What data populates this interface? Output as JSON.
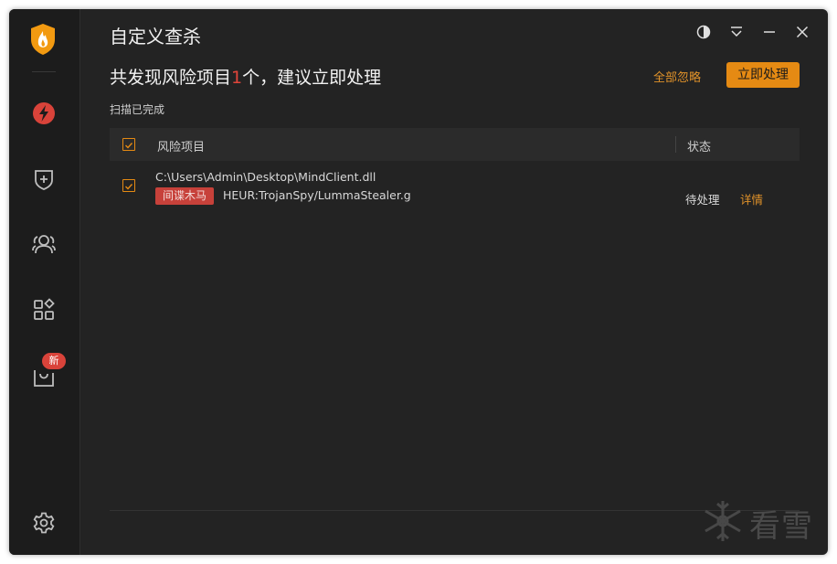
{
  "app": {
    "title": "自定义查杀"
  },
  "sidebar": {
    "items": [
      {
        "name": "scan",
        "icon": "lightning-icon"
      },
      {
        "name": "protection",
        "icon": "shield-plus-icon"
      },
      {
        "name": "users",
        "icon": "users-icon"
      },
      {
        "name": "apps",
        "icon": "apps-icon"
      },
      {
        "name": "store",
        "icon": "bag-icon",
        "badge": "新"
      }
    ],
    "settings_icon": "gear-icon"
  },
  "window_controls": [
    "theme-icon",
    "menu-icon",
    "minimize-icon",
    "close-icon"
  ],
  "summary": {
    "prefix": "共发现风险项目",
    "count": "1",
    "suffix": "个，建议立即处理",
    "status": "扫描已完成"
  },
  "actions": {
    "ignore_all": "全部忽略",
    "handle_now": "立即处理"
  },
  "table": {
    "columns": {
      "name": "风险项目",
      "status": "状态"
    },
    "rows": [
      {
        "path": "C:\\Users\\Admin\\Desktop\\MindClient.dll",
        "tag": "间谍木马",
        "virus": "HEUR:TrojanSpy/LummaStealer.g",
        "status": "待处理",
        "detail": "详情",
        "checked": true
      }
    ]
  },
  "watermark": {
    "text": "看雪"
  },
  "colors": {
    "accent": "#e58a13",
    "danger": "#d9433a",
    "background": "#232323",
    "sidebar": "#1c1c1c"
  }
}
